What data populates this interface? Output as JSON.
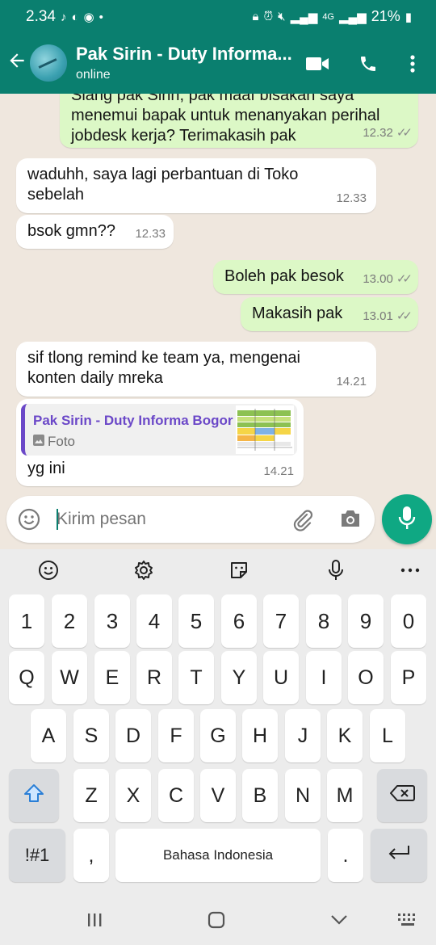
{
  "status_bar": {
    "time": "2.34",
    "battery": "21%",
    "network": "4G"
  },
  "chat_header": {
    "contact_name": "Pak Sirin - Duty Informa...",
    "status": "online"
  },
  "messages": [
    {
      "direction": "out",
      "text_line1": "Siang pak Sirin, pak maaf bisakah saya",
      "text_line2": "menemui bapak untuk menanyakan perihal",
      "text_line3": "jobdesk kerja? Terimakasih pak",
      "time": "12.32",
      "read": true
    },
    {
      "direction": "in",
      "text_line1": "waduhh, saya lagi perbantuan di Toko",
      "text_line2": "sebelah",
      "time": "12.33"
    },
    {
      "direction": "in",
      "text": "bsok gmn??",
      "time": "12.33"
    },
    {
      "direction": "out",
      "text": "Boleh pak besok",
      "time": "13.00",
      "read": true
    },
    {
      "direction": "out",
      "text": "Makasih pak",
      "time": "13.01",
      "read": true
    },
    {
      "direction": "in",
      "text_line1": "sif tlong remind ke team ya, mengenai",
      "text_line2": "konten daily mreka",
      "time": "14.21"
    },
    {
      "direction": "in",
      "quote": {
        "name": "Pak Sirin - Duty Informa Bogor",
        "type": "Foto"
      },
      "text": "yg ini",
      "time": "14.21"
    }
  ],
  "input": {
    "placeholder": "Kirim pesan"
  },
  "keyboard": {
    "number_row": [
      "1",
      "2",
      "3",
      "4",
      "5",
      "6",
      "7",
      "8",
      "9",
      "0"
    ],
    "row1": [
      "Q",
      "W",
      "E",
      "R",
      "T",
      "Y",
      "U",
      "I",
      "O",
      "P"
    ],
    "row2": [
      "A",
      "S",
      "D",
      "F",
      "G",
      "H",
      "J",
      "K",
      "L"
    ],
    "row3": [
      "Z",
      "X",
      "C",
      "V",
      "B",
      "N",
      "M"
    ],
    "symbols_key": "!#1",
    "comma_key": ",",
    "space_label": "Bahasa Indonesia",
    "period_key": "."
  },
  "colors": {
    "header": "#0a7f6f",
    "outgoing_bubble": "#dcf8c6",
    "incoming_bubble": "#ffffff",
    "mic_button": "#0fa883",
    "quote_accent": "#6b48c8"
  }
}
